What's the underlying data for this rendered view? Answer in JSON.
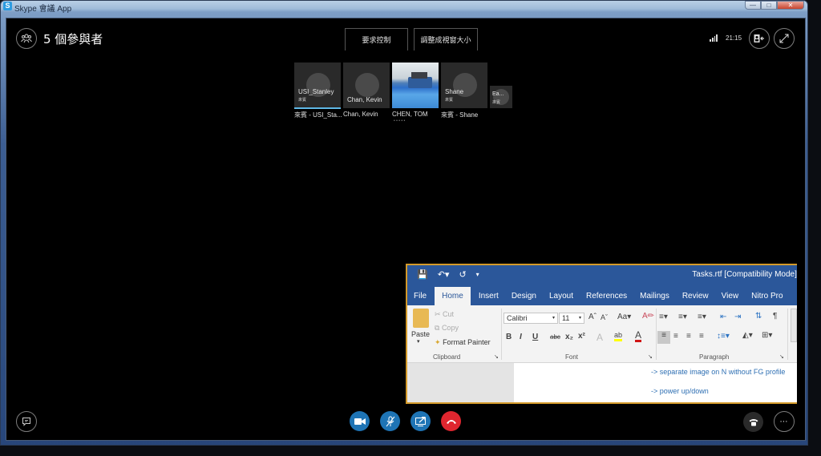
{
  "window": {
    "title": "Skype 會議 App",
    "controls": {
      "minimize": "—",
      "maximize": "□",
      "close": "✕"
    }
  },
  "header": {
    "participants_count_label": "5 個參與者",
    "request_control_label": "要求控制",
    "fit_to_window_label": "調整成視窗大小",
    "clock": "21:15",
    "icons": {
      "participants": "people-icon",
      "signal": "signal-strength-icon",
      "content_view": "presenter-view-icon",
      "fullscreen": "expand-icon"
    }
  },
  "participants": [
    {
      "tile_name": "USI_Stanley",
      "tile_sub": "來賓",
      "caption": "來賓 - USI_Sta...",
      "active": true,
      "has_video": false
    },
    {
      "tile_name": "Chan, Kevin",
      "tile_sub": "",
      "caption": "Chan, Kevin",
      "active": false,
      "has_video": false
    },
    {
      "tile_name": "",
      "tile_sub": "",
      "caption": "CHEN, TOM",
      "caption_sub": "• • • • •",
      "active": false,
      "has_video": true
    },
    {
      "tile_name": "Shane",
      "tile_sub": "來賓",
      "caption": "來賓 - Shane",
      "active": false,
      "has_video": false
    },
    {
      "tile_name": "Ea...",
      "tile_sub": "來賓",
      "caption": "",
      "active": false,
      "has_video": false
    }
  ],
  "shared_screen": {
    "title": "Tasks.rtf [Compatibility Mode]  -",
    "qat": {
      "save": "save-icon",
      "undo": "undo-icon",
      "redo": "redo-icon",
      "customize": "customize-qat-icon"
    },
    "tabs": [
      "File",
      "Home",
      "Insert",
      "Design",
      "Layout",
      "References",
      "Mailings",
      "Review",
      "View",
      "Nitro Pro"
    ],
    "active_tab": "Home",
    "clipboard": {
      "paste": "Paste",
      "cut": "Cut",
      "copy": "Copy",
      "format_painter": "Format Painter",
      "label": "Clipboard"
    },
    "font": {
      "name": "Calibri",
      "size": "11",
      "label": "Font",
      "buttons": [
        "B",
        "I",
        "U",
        "abc",
        "x₂",
        "x²"
      ]
    },
    "paragraph": {
      "label": "Paragraph"
    },
    "document_lines": [
      "-> separate image on N without FG profile",
      "-> power up/down"
    ]
  },
  "call_controls": {
    "video": "video-camera-icon",
    "mute": "microphone-muted-icon",
    "share": "share-screen-icon",
    "hangup": "hang-up-icon",
    "chat": "chat-icon",
    "dialpad": "phone-icon",
    "more": "more-options-icon",
    "colors": {
      "blue": "#1e74b5",
      "red": "#e0262f"
    }
  }
}
